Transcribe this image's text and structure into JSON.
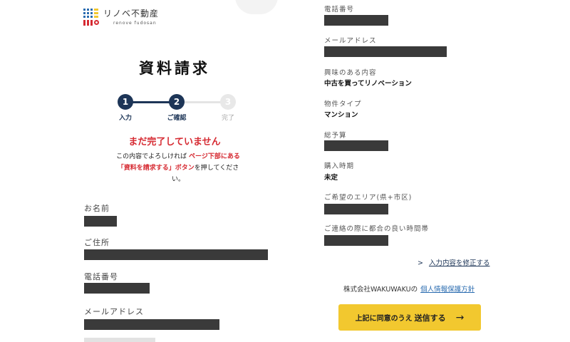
{
  "logo": {
    "text": "リノベ不動産",
    "subtext": "renove fudosan"
  },
  "page_title": "資料請求",
  "stepper": {
    "steps": [
      {
        "number": "1",
        "label": "入力",
        "state": "done"
      },
      {
        "number": "2",
        "label": "ご確認",
        "state": "current"
      },
      {
        "number": "3",
        "label": "完了",
        "state": "upcoming"
      }
    ]
  },
  "warning": {
    "title": "まだ完了していません",
    "line1_prefix": "この内容でよろしければ",
    "line1_highlight": "ページ下部にある",
    "line2_highlight": "「資料を請求する」ボタン",
    "line2_suffix": "を押してくださ",
    "line3": "い。"
  },
  "left_fields": {
    "name_label": "お名前",
    "address_label": "ご住所",
    "phone_label": "電話番号",
    "email_label": "メールアドレス"
  },
  "right_fields": {
    "phone_label": "電話番号",
    "email_label": "メールアドレス",
    "interest_label": "興味のある内容",
    "interest_value": "中古を買ってリノベーション",
    "property_type_label": "物件タイプ",
    "property_type_value": "マンション",
    "budget_label": "総予算",
    "timing_label": "購入時期",
    "timing_value": "未定",
    "area_label": "ご希望のエリア(県+市区)",
    "contact_time_label": "ご連絡の際に都合の良い時間帯"
  },
  "edit_link": {
    "chevron": ">",
    "label": "入力内容を修正する"
  },
  "consent": {
    "company": "株式会社WAKUWAKUの",
    "policy_link": "個人情報保護方針"
  },
  "submit": {
    "prefix": "上記に同意のうえ",
    "label": "送信する",
    "arrow": "→"
  },
  "colors": {
    "navy": "#1d3557",
    "red": "#d62b33",
    "yellow": "#f2c82f",
    "link": "#2b6cb0",
    "redact": "#3a3a3a"
  },
  "icons": {
    "logo_mark": "logo-grid-icon",
    "chevron": "chevron-right-icon",
    "arrow": "arrow-right-icon"
  }
}
